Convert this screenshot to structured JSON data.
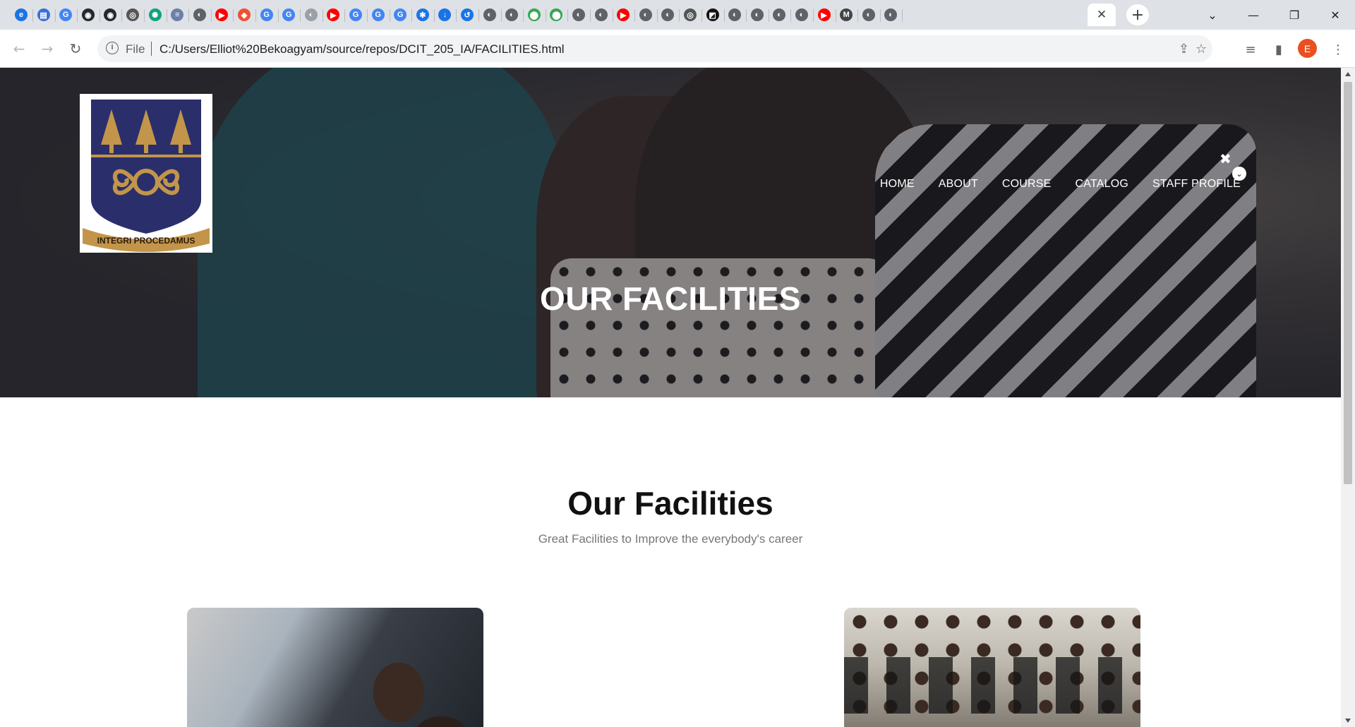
{
  "browser": {
    "tabs": [
      {
        "icon": "edge-icon",
        "color": "#1a73e8",
        "glyph": "e"
      },
      {
        "icon": "printer-icon",
        "color": "#3b6fd8",
        "glyph": "▤"
      },
      {
        "icon": "google-icon",
        "color": "#4285f4",
        "glyph": "G"
      },
      {
        "icon": "github-icon",
        "color": "#24292e",
        "glyph": "◉"
      },
      {
        "icon": "github-icon",
        "color": "#24292e",
        "glyph": "◉"
      },
      {
        "icon": "chrome-icon",
        "color": "#555",
        "glyph": "◎"
      },
      {
        "icon": "chatgpt-icon",
        "color": "#10a37f",
        "glyph": "✺"
      },
      {
        "icon": "site-icon",
        "color": "#6b7fa8",
        "glyph": "≡"
      },
      {
        "icon": "globe-icon",
        "color": "#5f6368",
        "glyph": "◐"
      },
      {
        "icon": "youtube-icon",
        "color": "#ff0000",
        "glyph": "▶"
      },
      {
        "icon": "git-icon",
        "color": "#f05032",
        "glyph": "◆"
      },
      {
        "icon": "google-icon",
        "color": "#4285f4",
        "glyph": "G"
      },
      {
        "icon": "google-icon",
        "color": "#4285f4",
        "glyph": "G"
      },
      {
        "icon": "globe-icon",
        "color": "#9aa0a6",
        "glyph": "◐"
      },
      {
        "icon": "youtube-icon",
        "color": "#ff0000",
        "glyph": "▶"
      },
      {
        "icon": "google-icon",
        "color": "#4285f4",
        "glyph": "G"
      },
      {
        "icon": "google-icon",
        "color": "#4285f4",
        "glyph": "G"
      },
      {
        "icon": "google-icon",
        "color": "#4285f4",
        "glyph": "G"
      },
      {
        "icon": "settings-icon",
        "color": "#1a73e8",
        "glyph": "✱"
      },
      {
        "icon": "download-icon",
        "color": "#1a73e8",
        "glyph": "↓"
      },
      {
        "icon": "history-icon",
        "color": "#1a73e8",
        "glyph": "↺"
      },
      {
        "icon": "globe-icon",
        "color": "#5f6368",
        "glyph": "◐"
      },
      {
        "icon": "globe-icon",
        "color": "#5f6368",
        "glyph": "◐"
      },
      {
        "icon": "maps-icon",
        "color": "#34a853",
        "glyph": "⬤"
      },
      {
        "icon": "maps-icon",
        "color": "#34a853",
        "glyph": "⬤"
      },
      {
        "icon": "globe-icon",
        "color": "#5f6368",
        "glyph": "◐"
      },
      {
        "icon": "globe-icon",
        "color": "#5f6368",
        "glyph": "◐"
      },
      {
        "icon": "youtube-icon",
        "color": "#ff0000",
        "glyph": "▶"
      },
      {
        "icon": "globe-icon",
        "color": "#5f6368",
        "glyph": "◐"
      },
      {
        "icon": "globe-icon",
        "color": "#5f6368",
        "glyph": "◐"
      },
      {
        "icon": "chrome-icon",
        "color": "#555",
        "glyph": "◎"
      },
      {
        "icon": "app-icon",
        "color": "#111",
        "glyph": "◩"
      },
      {
        "icon": "globe-icon",
        "color": "#5f6368",
        "glyph": "◐"
      },
      {
        "icon": "globe-icon",
        "color": "#5f6368",
        "glyph": "◐"
      },
      {
        "icon": "globe-icon",
        "color": "#5f6368",
        "glyph": "◐"
      },
      {
        "icon": "globe-icon",
        "color": "#5f6368",
        "glyph": "◐"
      },
      {
        "icon": "youtube-icon",
        "color": "#ff0000",
        "glyph": "▶"
      },
      {
        "icon": "markdown-icon",
        "color": "#444",
        "glyph": "M"
      },
      {
        "icon": "globe-icon",
        "color": "#5f6368",
        "glyph": "◐"
      },
      {
        "icon": "globe-icon",
        "color": "#5f6368",
        "glyph": "◐"
      }
    ],
    "active_tab_close": "✕",
    "new_tab": "+",
    "window_controls": {
      "tab_search": "⌄",
      "minimize": "—",
      "restore": "❐",
      "close": "✕"
    },
    "url_scheme_label": "File",
    "url": "C:/Users/Elliot%20Bekoagyam/source/repos/DCIT_205_IA/FACILITIES.html",
    "profile_initial": "E"
  },
  "site": {
    "logo_motto": "INTEGRI PROCEDAMUS",
    "nav": [
      {
        "label": "HOME"
      },
      {
        "label": "ABOUT"
      },
      {
        "label": "COURSE"
      },
      {
        "label": "CATALOG"
      },
      {
        "label": "STAFF PROFILE"
      }
    ],
    "hero_title": "OUR FACILITIES",
    "section_title": "Our Facilities",
    "section_subtitle": "Great Facilities to Improve the everybody's career"
  },
  "colors": {
    "shield_navy": "#2a2f6b",
    "crest_gold": "#c2954a",
    "avatar": "#e8501f"
  }
}
